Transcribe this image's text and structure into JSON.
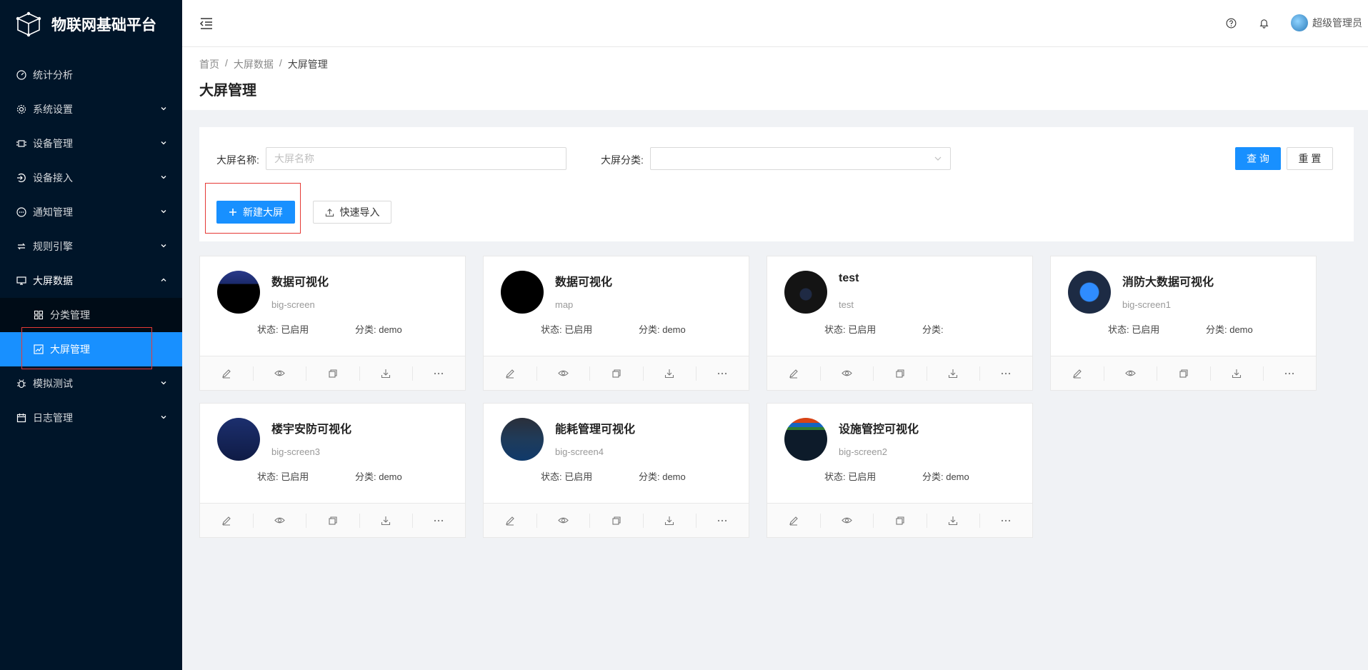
{
  "app": {
    "title": "物联网基础平台"
  },
  "sidebar": {
    "items": [
      {
        "label": "统计分析",
        "icon": "dashboard-icon",
        "has_arrow": false
      },
      {
        "label": "系统设置",
        "icon": "gear-icon",
        "has_arrow": true
      },
      {
        "label": "设备管理",
        "icon": "device-icon",
        "has_arrow": true
      },
      {
        "label": "设备接入",
        "icon": "access-icon",
        "has_arrow": true
      },
      {
        "label": "通知管理",
        "icon": "message-icon",
        "has_arrow": true
      },
      {
        "label": "规则引擎",
        "icon": "rule-icon",
        "has_arrow": true
      },
      {
        "label": "大屏数据",
        "icon": "desktop-icon",
        "has_arrow": true,
        "open": true
      },
      {
        "label": "模拟测试",
        "icon": "bug-icon",
        "has_arrow": true
      },
      {
        "label": "日志管理",
        "icon": "calendar-icon",
        "has_arrow": true
      }
    ],
    "sub_items": [
      {
        "label": "分类管理",
        "icon": "appstore-icon"
      },
      {
        "label": "大屏管理",
        "icon": "chart-icon",
        "active": true
      }
    ]
  },
  "header": {
    "user": "超级管理员"
  },
  "breadcrumb": [
    "首页",
    "大屏数据",
    "大屏管理"
  ],
  "page_title": "大屏管理",
  "search": {
    "name_label": "大屏名称:",
    "name_placeholder": "大屏名称",
    "category_label": "大屏分类:",
    "query_button": "查 询",
    "reset_button": "重 置",
    "new_button": "新建大屏",
    "import_button": "快速导入"
  },
  "cards": [
    {
      "title": "数据可视化",
      "desc": "big-screen",
      "status": "状态: 已启用",
      "category": "分类: demo",
      "thumb": "dark-blue"
    },
    {
      "title": "数据可视化",
      "desc": "map",
      "status": "状态: 已启用",
      "category": "分类: demo",
      "thumb": "black"
    },
    {
      "title": "test",
      "desc": "test",
      "status": "状态: 已启用",
      "category": "分类:",
      "thumb": "dark"
    },
    {
      "title": "消防大数据可视化",
      "desc": "big-screen1",
      "status": "状态: 已启用",
      "category": "分类: demo",
      "thumb": "blue-map"
    },
    {
      "title": "楼宇安防可视化",
      "desc": "big-screen3",
      "status": "状态: 已启用",
      "category": "分类: demo",
      "thumb": "navy"
    },
    {
      "title": "能耗管理可视化",
      "desc": "big-screen4",
      "status": "状态: 已启用",
      "category": "分类: demo",
      "thumb": "panel"
    },
    {
      "title": "设施管控可视化",
      "desc": "big-screen2",
      "status": "状态: 已启用",
      "category": "分类: demo",
      "thumb": "colorful"
    }
  ],
  "card_actions": [
    "edit-icon",
    "eye-icon",
    "copy-icon",
    "download-icon",
    "more-icon"
  ],
  "colors": {
    "sidebar_bg": "#001529",
    "primary": "#1890ff",
    "highlight": "#e53935"
  }
}
